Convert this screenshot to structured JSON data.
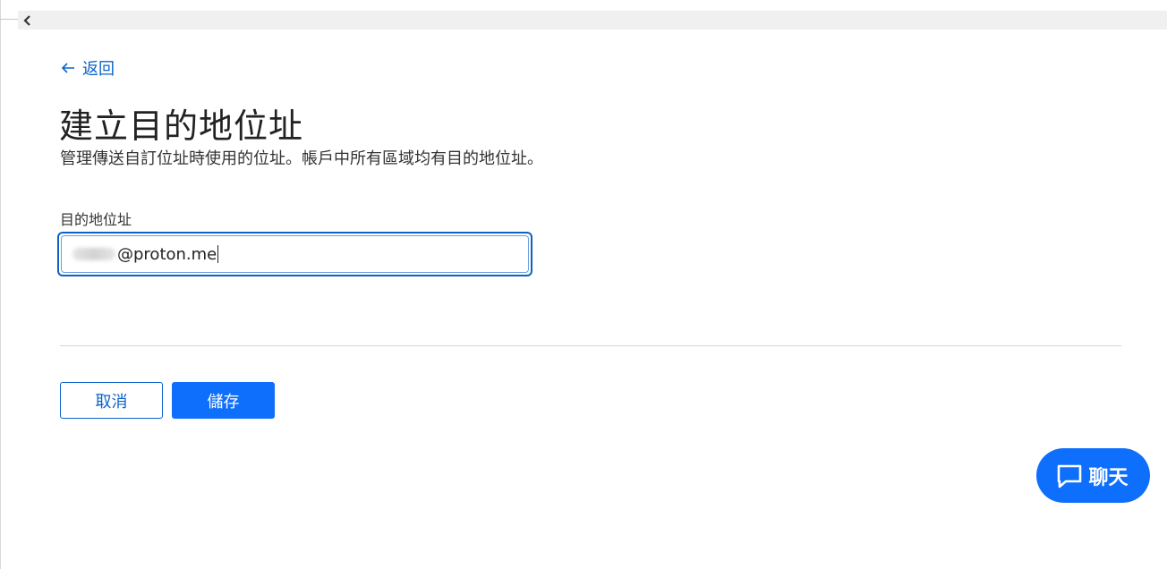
{
  "nav": {
    "back_label": "返回"
  },
  "page": {
    "title": "建立目的地位址",
    "description": "管理傳送自訂位址時使用的位址。帳戶中所有區域均有目的地位址。"
  },
  "form": {
    "destination_label": "目的地位址",
    "destination_value": "@proton.me"
  },
  "actions": {
    "cancel_label": "取消",
    "save_label": "儲存"
  },
  "chat": {
    "label": "聊天"
  },
  "colors": {
    "accent": "#0e6ffd",
    "link": "#0a62c9"
  }
}
